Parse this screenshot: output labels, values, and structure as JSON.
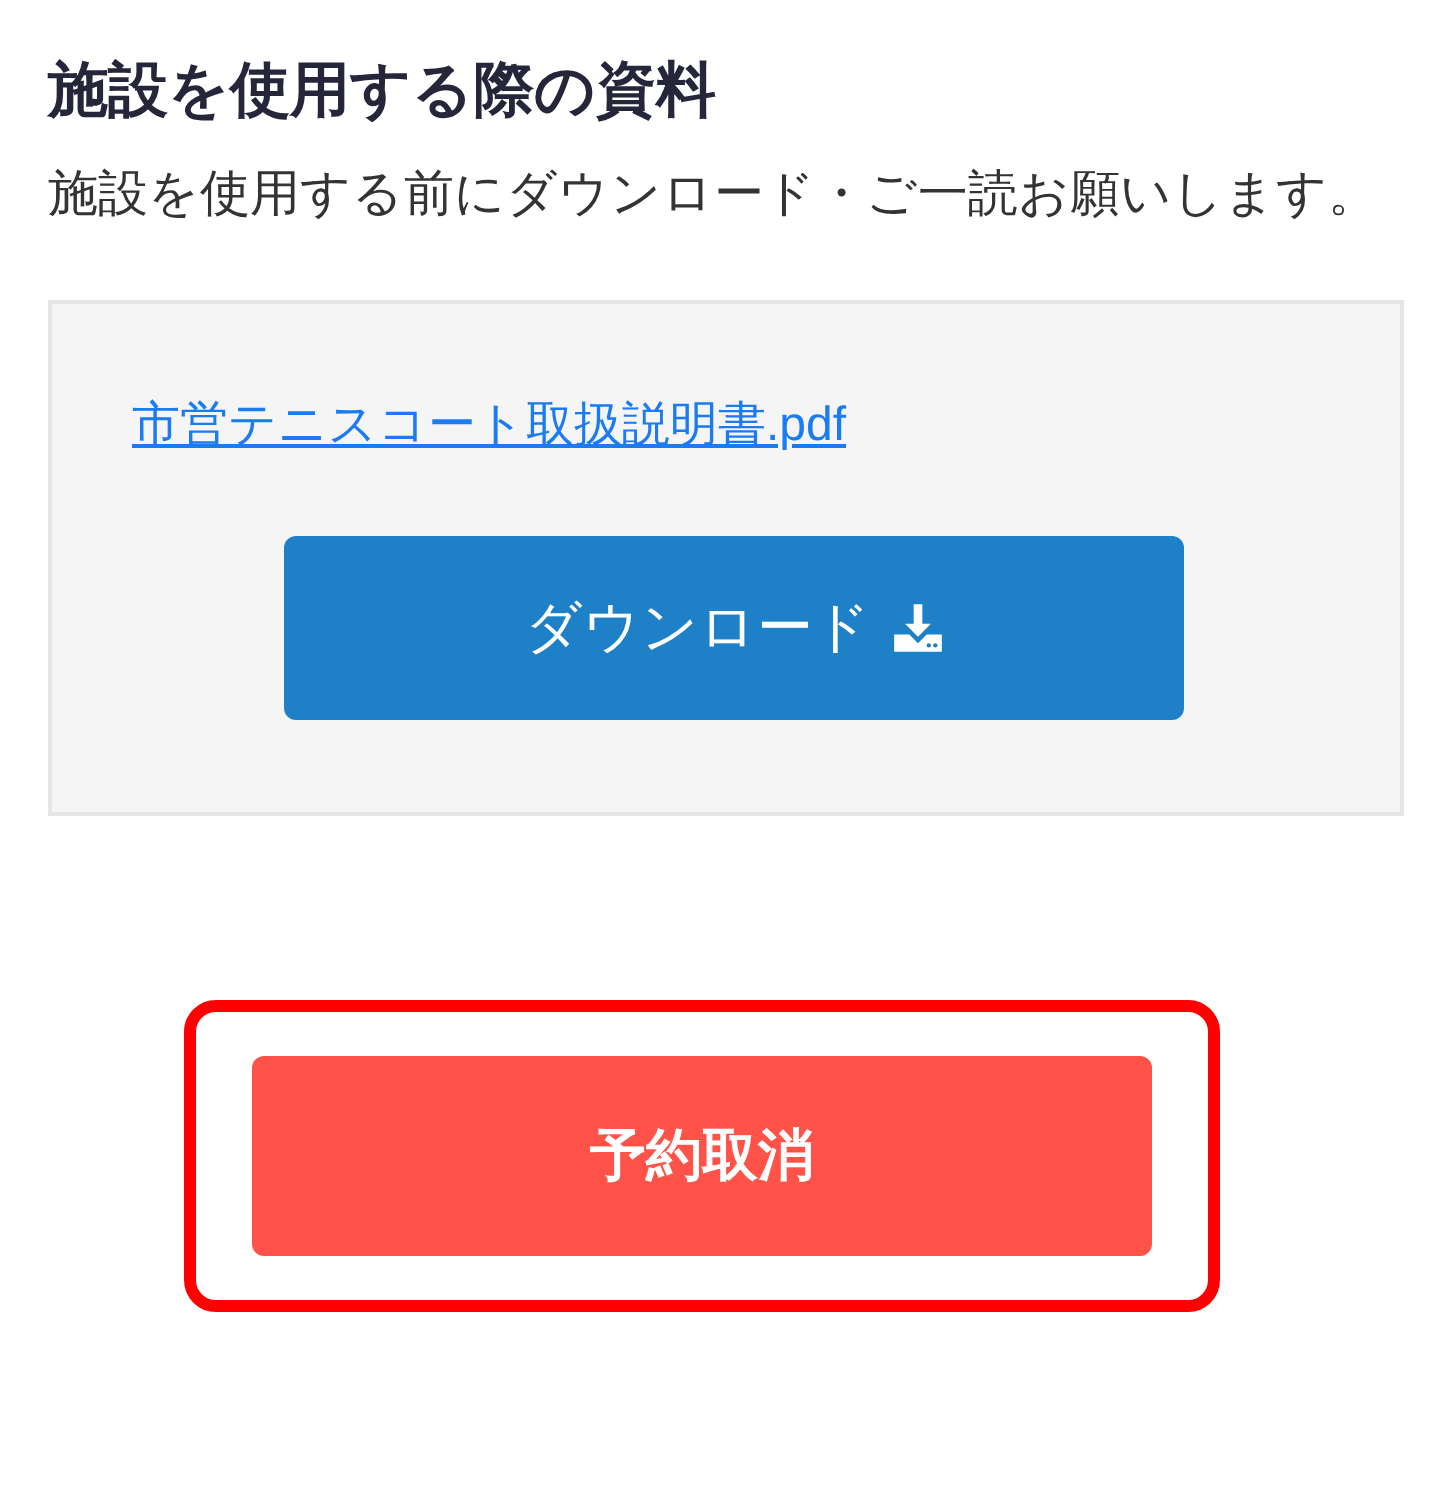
{
  "heading": "施設を使用する際の資料",
  "description": "施設を使用する前にダウンロード・ご一読お願いします。",
  "documents": [
    {
      "link": "市営テニスコート取扱説明書.pdf",
      "button": "ダウンロード"
    }
  ],
  "cancel": {
    "label": "予約取消",
    "highlighted": true
  }
}
